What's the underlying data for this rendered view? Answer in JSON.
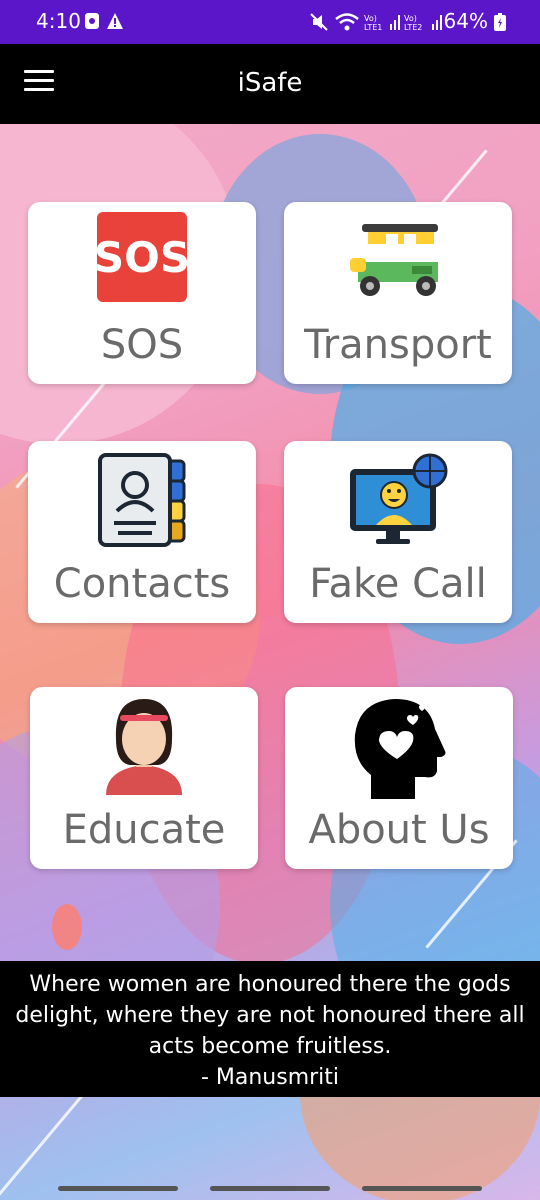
{
  "status_bar": {
    "time": "4:10",
    "battery": "64%",
    "icons": [
      "screen-record-icon",
      "alert-icon",
      "mute-icon",
      "wifi-icon",
      "volte-lte1-signal-icon",
      "volte-lte2-signal-icon",
      "battery-icon"
    ]
  },
  "app_bar": {
    "title": "iSafe",
    "menu_icon": "hamburger-menu-icon"
  },
  "tiles": [
    {
      "label": "SOS",
      "icon": "sos-icon"
    },
    {
      "label": "Transport",
      "icon": "auto-rickshaw-icon"
    },
    {
      "label": "Contacts",
      "icon": "contact-book-icon"
    },
    {
      "label": "Fake Call",
      "icon": "video-call-monitor-icon"
    },
    {
      "label": "Educate",
      "icon": "woman-avatar-icon"
    },
    {
      "label": "About Us",
      "icon": "head-heart-icon"
    }
  ],
  "quote": {
    "text": "Where women are honoured there the gods delight, where they are not honoured there all acts become fruitless.",
    "author": "- Manusmriti"
  },
  "colors": {
    "status_bar": "#5b16c9",
    "app_bar": "#000000",
    "tile_text": "#6a6a6a"
  }
}
